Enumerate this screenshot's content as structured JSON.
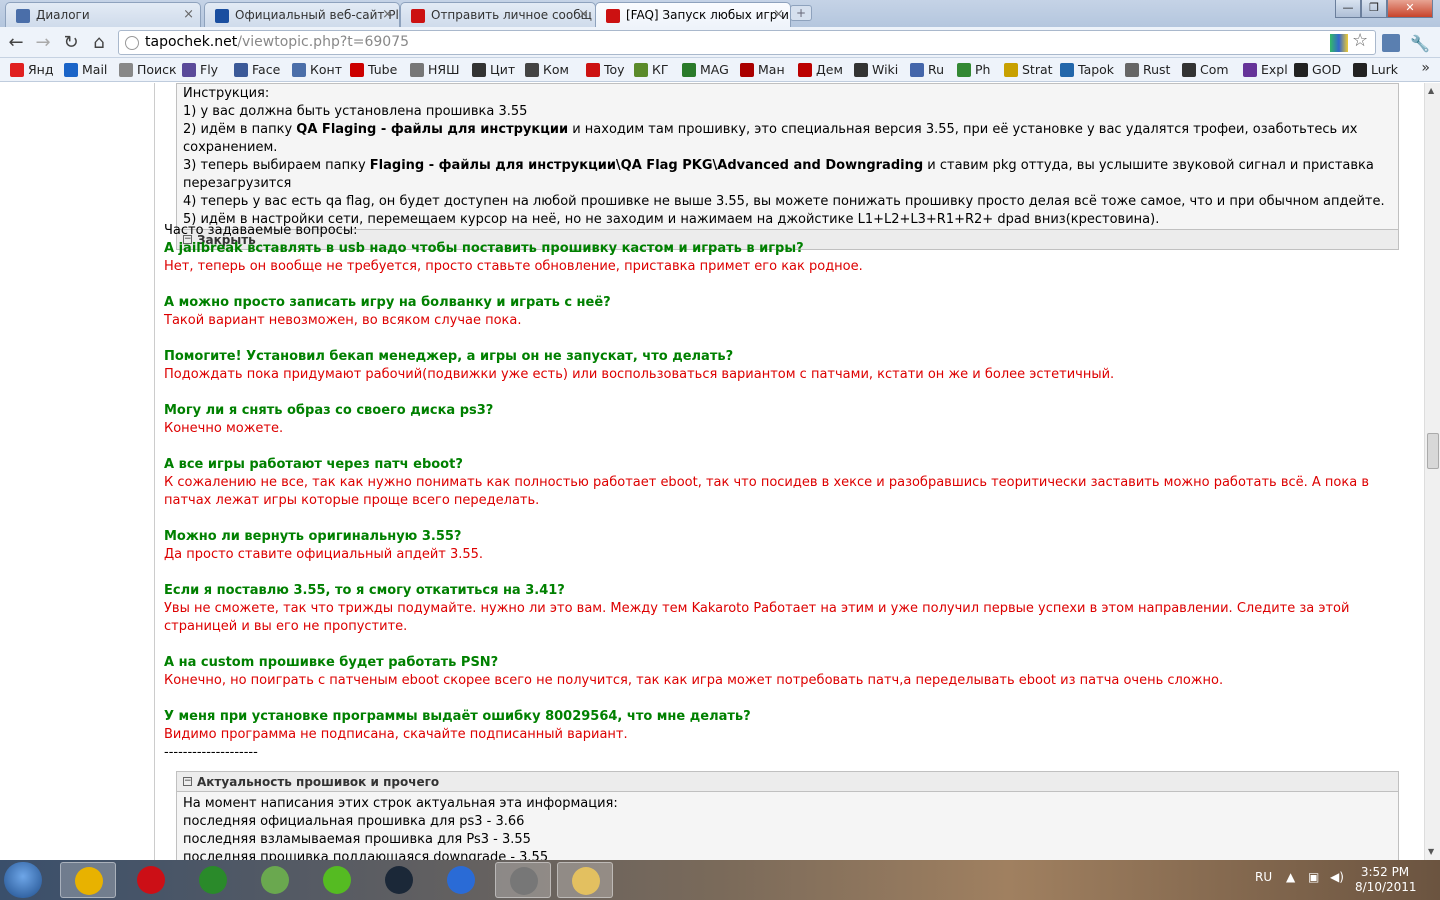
{
  "tabs": [
    {
      "label": "Диалоги",
      "icon": "vk-icon",
      "active": false
    },
    {
      "label": "Официальный веб-сайт Pl",
      "icon": "playstation-icon",
      "active": false
    },
    {
      "label": "Отправить личное сообщ",
      "icon": "tapochek-icon",
      "active": false
    },
    {
      "label": "[FAQ] Запуск любых игр и",
      "icon": "tapochek-icon",
      "active": true
    }
  ],
  "window_controls": {
    "minimize": "—",
    "maximize": "❐",
    "close": "✕"
  },
  "toolbar": {
    "url_host": "tapochek.net",
    "url_path": "/viewtopic.php?t=69075"
  },
  "bookmarks": [
    {
      "label": "Янд",
      "icon": "yandex-icon",
      "color": "#e02020"
    },
    {
      "label": "Mail",
      "icon": "mail-icon",
      "color": "#1a64c8"
    },
    {
      "label": "Поиск",
      "icon": "search-icon",
      "color": "#888888"
    },
    {
      "label": "Fly",
      "icon": "fly-icon",
      "color": "#5a4a9a"
    },
    {
      "label": "Face",
      "icon": "facebook-icon",
      "color": "#3b5998"
    },
    {
      "label": "Конт",
      "icon": "vk-icon",
      "color": "#4a6ea9"
    },
    {
      "label": "Tube",
      "icon": "youtube-icon",
      "color": "#cc0000"
    },
    {
      "label": "НЯШ",
      "icon": "nyash-icon",
      "color": "#777777"
    },
    {
      "label": "Цит",
      "icon": "quote-icon",
      "color": "#333333"
    },
    {
      "label": "Ком",
      "icon": "comics-icon",
      "color": "#444444"
    },
    {
      "label": "Toy",
      "icon": "tapochek-icon",
      "color": "#cc1111"
    },
    {
      "label": "КГ",
      "icon": "kg-icon",
      "color": "#5a8a2a"
    },
    {
      "label": "MAG",
      "icon": "gmi-icon",
      "color": "#2a7a2a"
    },
    {
      "label": "Ман",
      "icon": "manga-icon",
      "color": "#aa0000"
    },
    {
      "label": "Дем",
      "icon": "dem-icon",
      "color": "#bb0000"
    },
    {
      "label": "Wiki",
      "icon": "wikipedia-icon",
      "color": "#333333"
    },
    {
      "label": "Ru",
      "icon": "ru-icon",
      "color": "#4466aa"
    },
    {
      "label": "Ph",
      "icon": "ph-icon",
      "color": "#338833"
    },
    {
      "label": "Strat",
      "icon": "trophy-icon",
      "color": "#c8a000"
    },
    {
      "label": "Tapok",
      "icon": "tapok-icon",
      "color": "#2266aa"
    },
    {
      "label": "Rust",
      "icon": "rust-icon",
      "color": "#666666"
    },
    {
      "label": "Com",
      "icon": "comment-icon",
      "color": "#333333"
    },
    {
      "label": "Expl",
      "icon": "expl-icon",
      "color": "#663399"
    },
    {
      "label": "GOD",
      "icon": "god-icon",
      "color": "#222222"
    },
    {
      "label": "Lurk",
      "icon": "lurk-icon",
      "color": "#222222"
    }
  ],
  "instruction_spoiler": {
    "lines": [
      {
        "text": "Инструкция:"
      },
      {
        "text": "1) у вас должна быть установлена прошивка 3.55"
      },
      {
        "pre": "2) идём в папку ",
        "bold": "QA Flaging - файлы для инструкции",
        "post": " и находим там прошивку, это специальная версия 3.55, при её установке у вас удалятся трофеи, озаботьтесь их сохранением."
      },
      {
        "pre": "3) теперь выбираем папку ",
        "bold": "Flaging - файлы для инструкции\\QA Flag PKG\\Advanced and Downgrading",
        "post": " и ставим pkg оттуда, вы услышите звуковой сигнал и приставка перезагрузится"
      },
      {
        "text": "4) теперь у вас есть qa flag, он будет доступен на любой прошивке не выше 3.55, вы можете понижать прошивку просто делая всё тоже самое, что и при обычном апдейте."
      },
      {
        "text": "5) идём в настройки сети, перемещаем курсор на неё, но не заходим и нажимаем на джойстике L1+L2+L3+R1+R2+ dpad вниз(крестовина)."
      }
    ],
    "close_label": "Закрыть"
  },
  "faq": {
    "heading": "Часто задаваемые вопросы:",
    "items": [
      {
        "q": "А jailbreak вставлять в usb надо чтобы поставить прошивку кастом и играть в игры?",
        "a": "Нет, теперь он вообще не требуется, просто ставьте обновление, приставка примет его как родное."
      },
      {
        "q": "А можно просто записать игру на болванку и играть с неё?",
        "a": "Такой вариант невозможен, во всяком случае пока."
      },
      {
        "q": "Помогите! Установил бекап менеджер, а игры он не запускат, что делать?",
        "a": "Подождать пока придумают рабочий(подвижки уже есть) или воспользоваться вариантом с патчами, кстати он же и более эстетичный."
      },
      {
        "q": "Могу ли я снять образ со своего диска ps3?",
        "a": "Конечно можете."
      },
      {
        "q": "А все игры работают через патч eboot?",
        "a": "К сожалению не все, так как нужно понимать как полностью работает eboot, так что посидев в хексе и разобравшись теоритически заставить можно работать всё. А пока в патчах лежат игры которые проще всего переделать."
      },
      {
        "q": "Можно ли вернуть оригинальную 3.55?",
        "a": "Да просто ставите официальный апдейт 3.55."
      },
      {
        "q": "Если я поставлю 3.55, то я смогу откатиться на 3.41?",
        "a": "Увы не сможете, так что трижды подумайте. нужно ли это вам. Между тем Kakaroto Работает на этим и уже получил первые успехи в этом направлении. Следите за этой страницей и вы его не пропустите."
      },
      {
        "q": "А на custom прошивке будет работать PSN?",
        "a": "Конечно, но поиграть с патченым eboot скорее всего не получится, так как игра может потребовать патч,а переделывать eboot из патча очень сложно."
      },
      {
        "q": "У меня при установке программы выдаёт ошибку 80029564, что мне делать?",
        "a": "Видимо программа не подписана, скачайте подписанный вариант."
      }
    ],
    "separator": "--------------------"
  },
  "actuality_spoiler": {
    "title": "Актуальность прошивок и прочего",
    "lines": [
      "На момент написания этих строк актуальная эта информация:",
      "последняя официальная прошивка для ps3 - 3.66",
      "последняя взламываемая прошивка для Ps3 - 3.55",
      "последняя прошивка поддающаяся downgrade - 3.55"
    ]
  },
  "taskbar": {
    "apps": [
      {
        "name": "chrome-taskbar-button",
        "icon": "chrome-icon",
        "color": "#e8b200",
        "active": true
      },
      {
        "name": "opera-taskbar-button",
        "icon": "opera-icon",
        "color": "#cc0f16",
        "active": false
      },
      {
        "name": "utorrent-taskbar-button",
        "icon": "utorrent-icon",
        "color": "#2a8a2a",
        "active": false
      },
      {
        "name": "trash-taskbar-button",
        "icon": "recycle-bin-icon",
        "color": "#6aa84f",
        "active": false
      },
      {
        "name": "icq-taskbar-button",
        "icon": "icq-icon",
        "color": "#55bb22",
        "active": false
      },
      {
        "name": "steam-taskbar-button",
        "icon": "steam-icon",
        "color": "#1b2838",
        "active": false
      },
      {
        "name": "itunes-taskbar-button",
        "icon": "itunes-icon",
        "color": "#2a6bd6",
        "active": false
      },
      {
        "name": "app-taskbar-button",
        "icon": "app-icon",
        "color": "#777777",
        "active": true
      },
      {
        "name": "explorer-taskbar-button",
        "icon": "folder-icon",
        "color": "#e3c060",
        "active": true
      }
    ],
    "lang": "RU",
    "time": "3:52 PM",
    "date": "8/10/2011"
  }
}
